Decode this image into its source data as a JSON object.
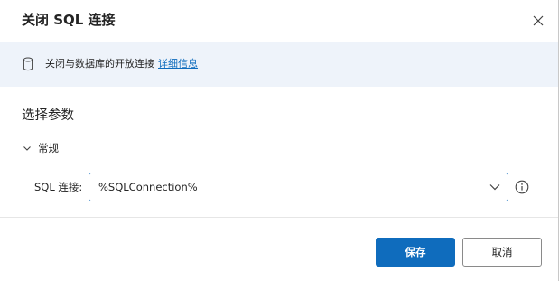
{
  "dialog": {
    "title": "关闭 SQL 连接"
  },
  "banner": {
    "icon": "database-icon",
    "text": "关闭与数据库的开放连接",
    "link_text": "详细信息"
  },
  "parameters": {
    "section_title": "选择参数",
    "group_label": "常规",
    "group_expanded": true,
    "sql_connection": {
      "label": "SQL 连接:",
      "value": "%SQLConnection%"
    }
  },
  "footer": {
    "save_label": "保存",
    "cancel_label": "取消"
  },
  "colors": {
    "accent": "#0f6cbd",
    "banner_bg": "#eef3fa"
  }
}
